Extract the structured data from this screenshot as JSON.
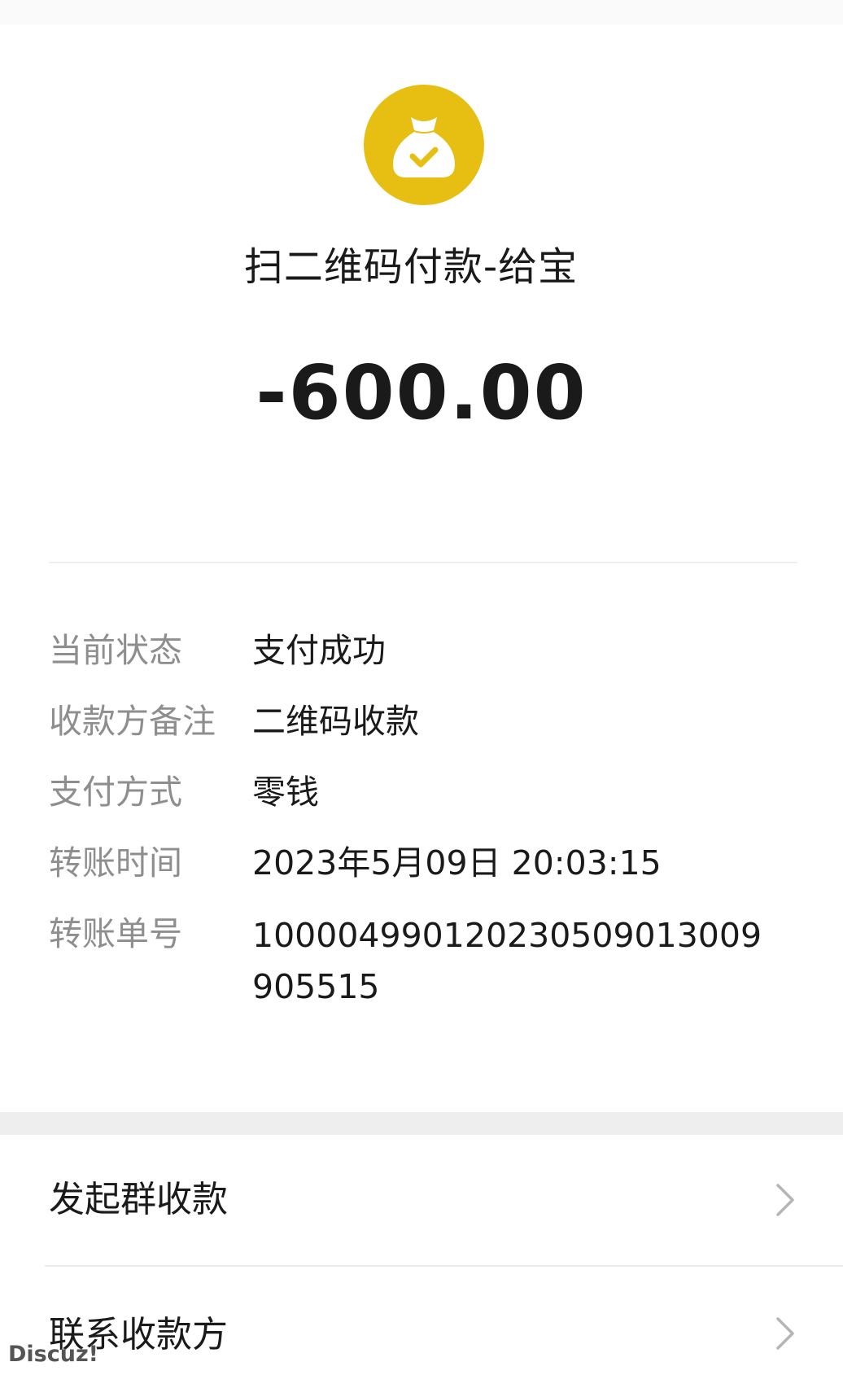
{
  "header": {
    "icon": "money-bag-check-icon",
    "icon_color": "#e7be12",
    "title": "扫二维码付款-给宝",
    "amount": "-600.00"
  },
  "details": [
    {
      "label": "当前状态",
      "value": "支付成功"
    },
    {
      "label": "收款方备注",
      "value": "二维码收款"
    },
    {
      "label": "支付方式",
      "value": "零钱"
    },
    {
      "label": "转账时间",
      "value": "2023年5月09日 20:03:15"
    },
    {
      "label": "转账单号",
      "value": "100004990120230509013009905515"
    }
  ],
  "actions": [
    {
      "label": "发起群收款",
      "icon": "chevron-right-icon"
    },
    {
      "label": "联系收款方",
      "icon": "chevron-right-icon"
    }
  ],
  "watermark": "Discuz!"
}
